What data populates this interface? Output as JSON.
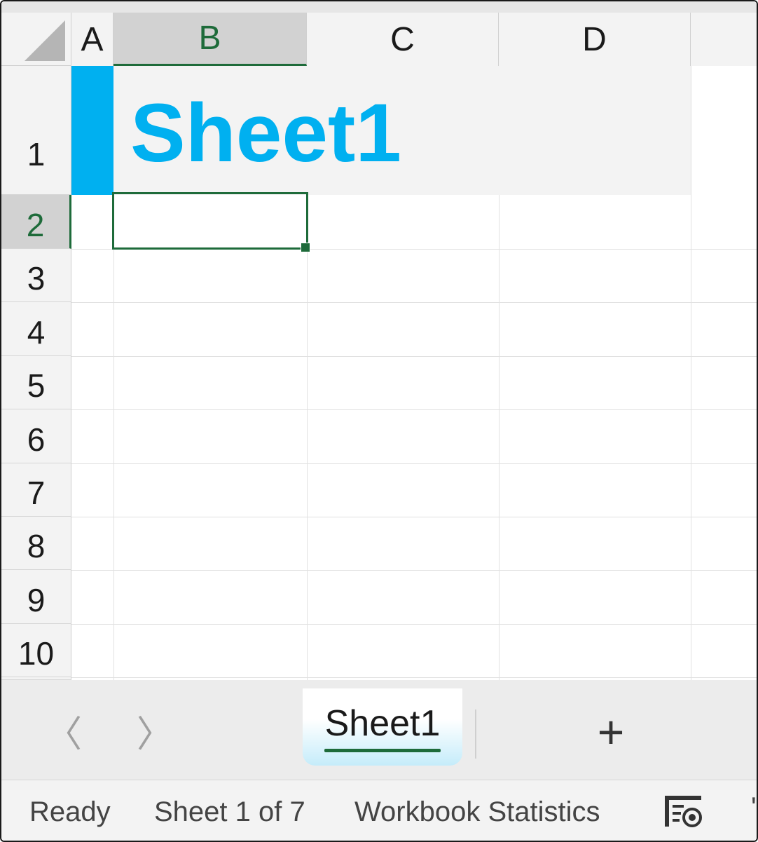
{
  "columns": [
    "A",
    "B",
    "C",
    "D"
  ],
  "rows": [
    "1",
    "2",
    "3",
    "4",
    "5",
    "6",
    "7",
    "8",
    "9",
    "10"
  ],
  "selected": {
    "column": "B",
    "row": "2"
  },
  "cells": {
    "B1": "Sheet1"
  },
  "accent_color": "#00b0f0",
  "selection_color": "#1e6b3a",
  "sheet_tabs": {
    "prev_icon": "chevron-left-icon",
    "next_icon": "chevron-right-icon",
    "prev_glyph": "〈",
    "next_glyph": "〉",
    "tabs": [
      {
        "label": "Sheet1",
        "active": true
      }
    ],
    "add_icon": "plus-icon",
    "add_glyph": "+"
  },
  "status_bar": {
    "ready": "Ready",
    "sheet_position": "Sheet 1 of 7",
    "workbook_statistics": "Workbook Statistics",
    "accessibility_icon": "accessibility-icon"
  }
}
